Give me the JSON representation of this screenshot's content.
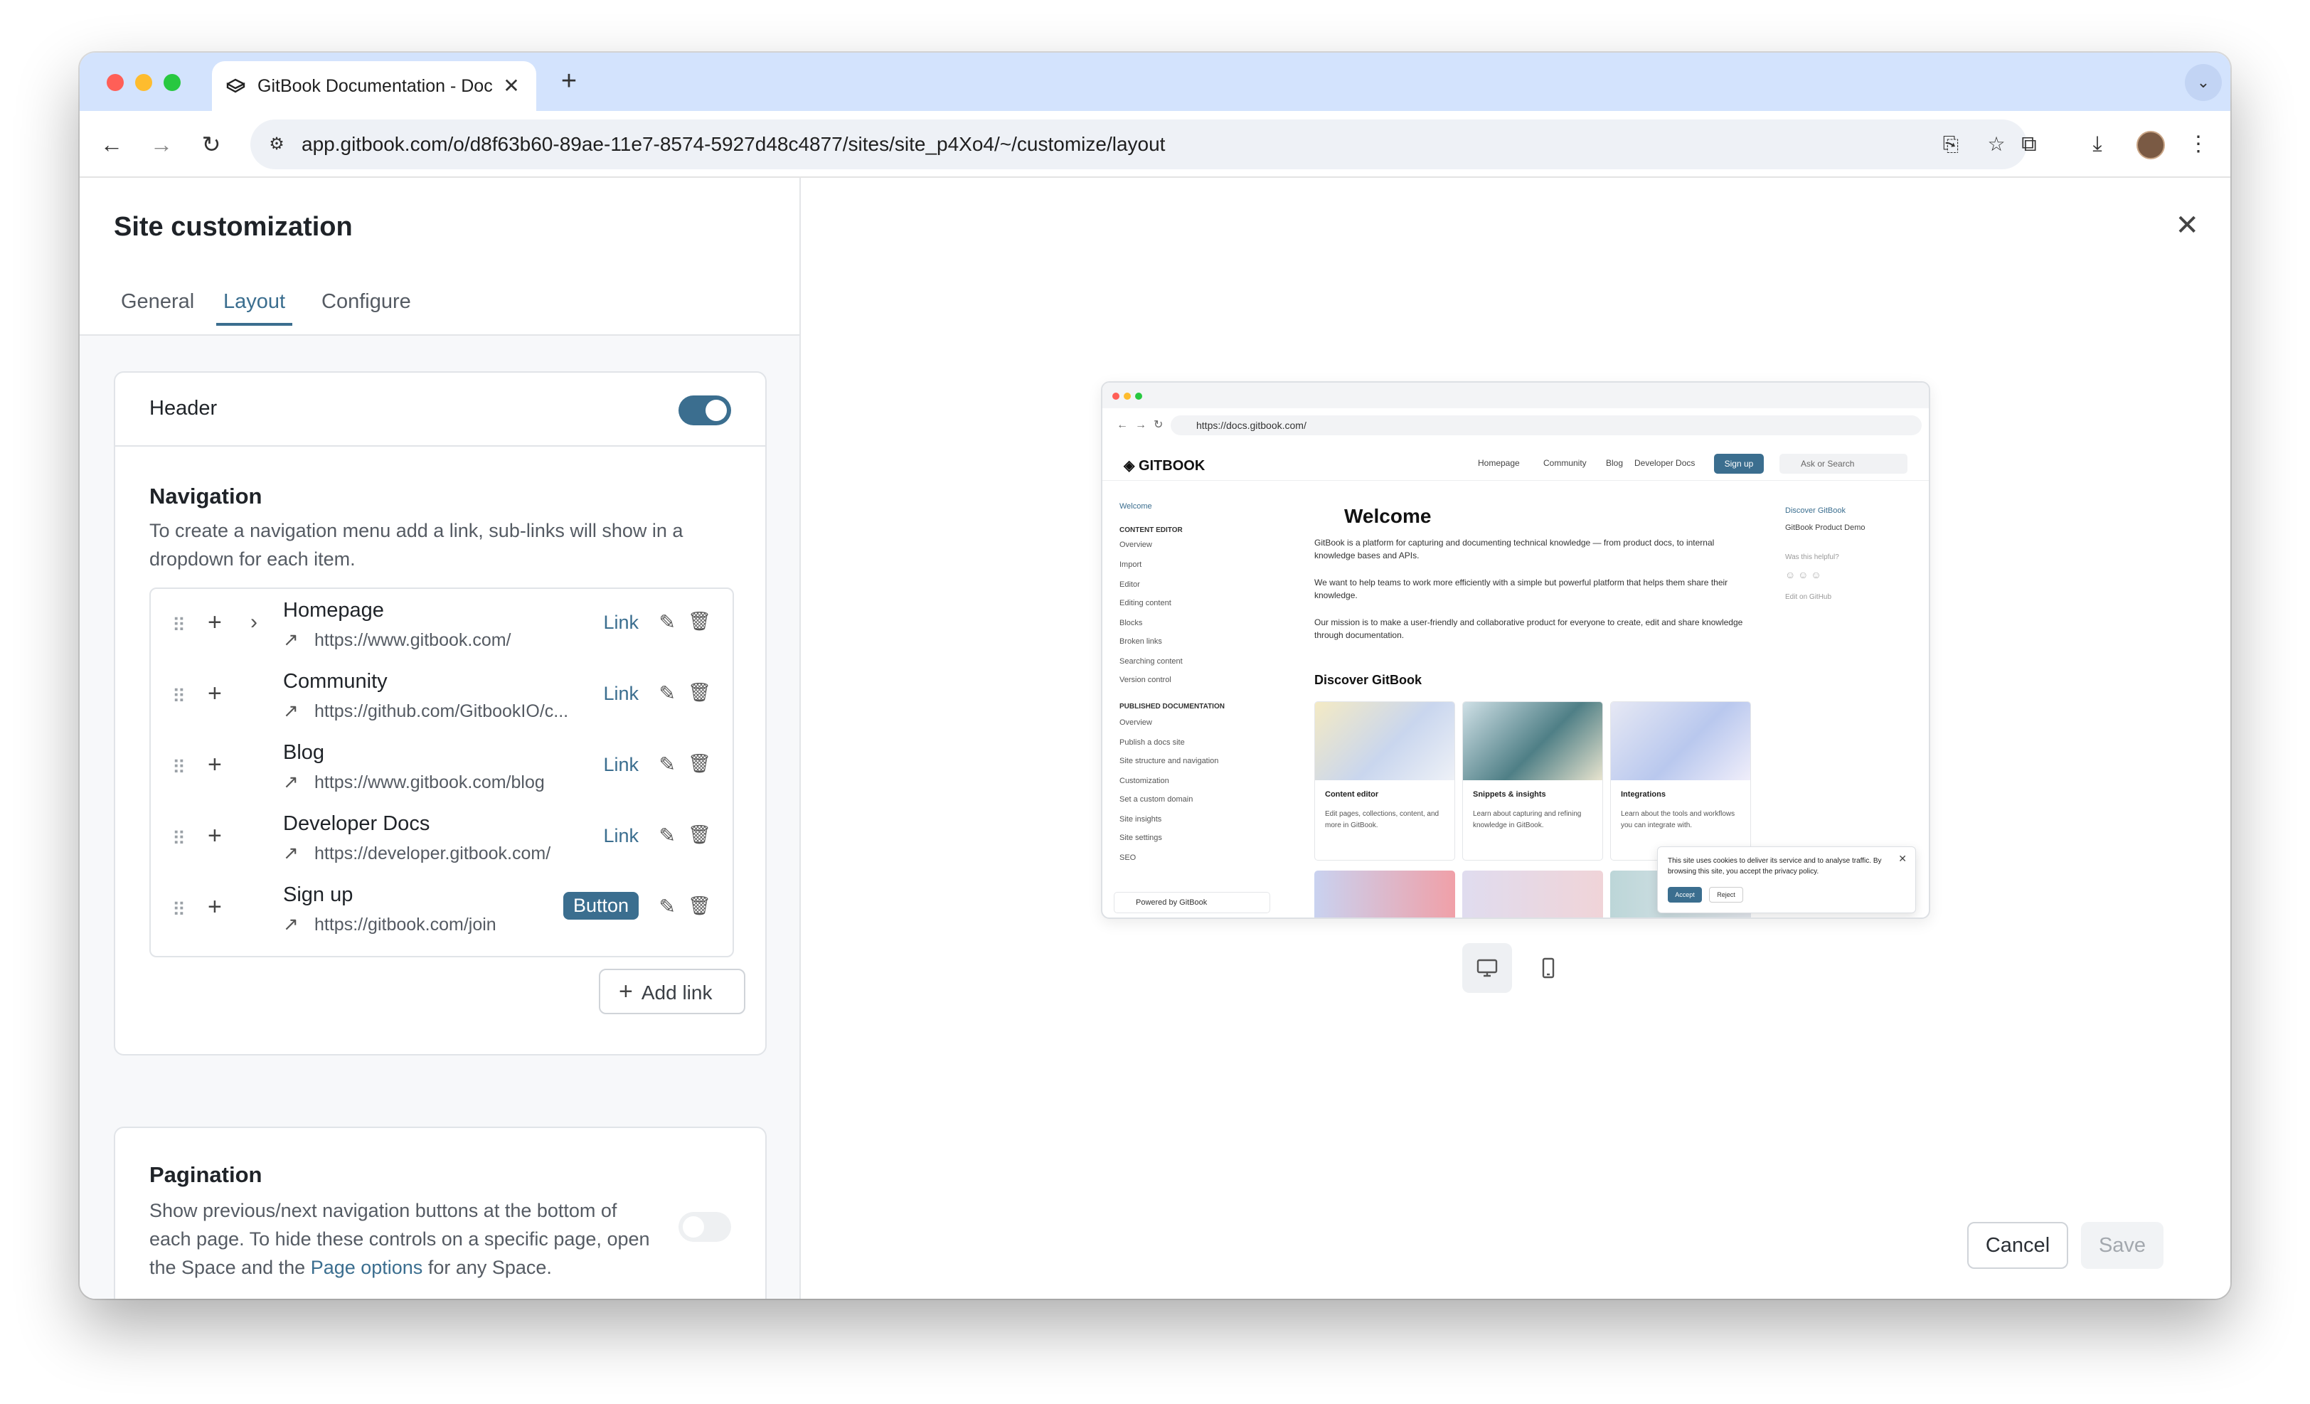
{
  "browser": {
    "tab_title": "GitBook Documentation - Doc",
    "url": "app.gitbook.com/o/d8f63b60-89ae-11e7-8574-5927d48c4877/sites/site_p4Xo4/~/customize/layout"
  },
  "panel": {
    "title": "Site customization",
    "tabs": [
      "General",
      "Layout",
      "Configure"
    ],
    "active_tab": "Layout"
  },
  "header_section": {
    "label": "Header",
    "toggle_on": true
  },
  "navigation": {
    "title": "Navigation",
    "description": "To create a navigation menu add a link, sub-links will show in a dropdown for each item.",
    "items": [
      {
        "name": "Homepage",
        "url": "https://www.gitbook.com/",
        "type": "Link",
        "has_children": true
      },
      {
        "name": "Community",
        "url": "https://github.com/GitbookIO/c...",
        "type": "Link",
        "has_children": false
      },
      {
        "name": "Blog",
        "url": "https://www.gitbook.com/blog",
        "type": "Link",
        "has_children": false
      },
      {
        "name": "Developer Docs",
        "url": "https://developer.gitbook.com/",
        "type": "Link",
        "has_children": false
      },
      {
        "name": "Sign up",
        "url": "https://gitbook.com/join",
        "type": "Button",
        "has_children": false
      }
    ],
    "add_link_label": "Add link"
  },
  "pagination": {
    "title": "Pagination",
    "description_before": "Show previous/next navigation buttons at the bottom of each page. To hide these controls on a specific page, open the Space and the ",
    "description_link": "Page options",
    "description_after": " for any Space.",
    "toggle_on": false
  },
  "preview": {
    "url": "https://docs.gitbook.com/",
    "logo": "GITBOOK",
    "menu": [
      "Homepage",
      "Community",
      "Blog",
      "Developer Docs"
    ],
    "signup": "Sign up",
    "search": "Ask or Search",
    "sidebar": {
      "welcome": "Welcome",
      "group1": "CONTENT EDITOR",
      "group1_items": [
        "Overview",
        "Import",
        "Editor",
        "Editing content",
        "Blocks",
        "Broken links",
        "Searching content",
        "Version control"
      ],
      "group2": "PUBLISHED DOCUMENTATION",
      "group2_items": [
        "Overview",
        "Publish a docs site",
        "Site structure and navigation",
        "Customization",
        "Set a custom domain",
        "Site insights",
        "Site settings",
        "SEO"
      ],
      "powered": "Powered by GitBook"
    },
    "heading": "Welcome",
    "paragraphs": [
      "GitBook is a platform for capturing and documenting technical knowledge — from product docs, to internal knowledge bases and APIs.",
      "We want to help teams to work more efficiently with a simple but powerful platform that helps them share their knowledge.",
      "Our mission is to make a user-friendly and collaborative product for everyone to create, edit and share knowledge through documentation."
    ],
    "discover_title": "Discover GitBook",
    "cards": [
      {
        "title": "Content editor",
        "desc": "Edit pages, collections, content, and more in GitBook."
      },
      {
        "title": "Snippets & insights",
        "desc": "Learn about capturing and refining knowledge in GitBook."
      },
      {
        "title": "Integrations",
        "desc": "Learn about the tools and workflows you can integrate with."
      }
    ],
    "toc": [
      "Discover GitBook",
      "GitBook Product Demo"
    ],
    "helpful": "Was this helpful?",
    "edit_github": "Edit on GitHub",
    "cookie_text": "This site uses cookies to deliver its service and to analyse traffic. By browsing this site, you accept the privacy policy.",
    "cookie_accept": "Accept",
    "cookie_reject": "Reject"
  },
  "actions": {
    "cancel": "Cancel",
    "save": "Save"
  },
  "colors": {
    "accent": "#3b6e8f",
    "tabstrip": "#d3e3fd"
  },
  "icons": [
    "gitbook-icon",
    "close-icon",
    "new-tab-icon",
    "back-icon",
    "forward-icon",
    "reload-icon",
    "site-settings-icon",
    "install-icon",
    "star-icon",
    "extensions-icon",
    "download-icon",
    "menu-icon",
    "drag-handle-icon",
    "plus-icon",
    "chevron-right-icon",
    "external-link-icon",
    "pencil-icon",
    "trash-icon",
    "desktop-icon",
    "mobile-icon"
  ]
}
